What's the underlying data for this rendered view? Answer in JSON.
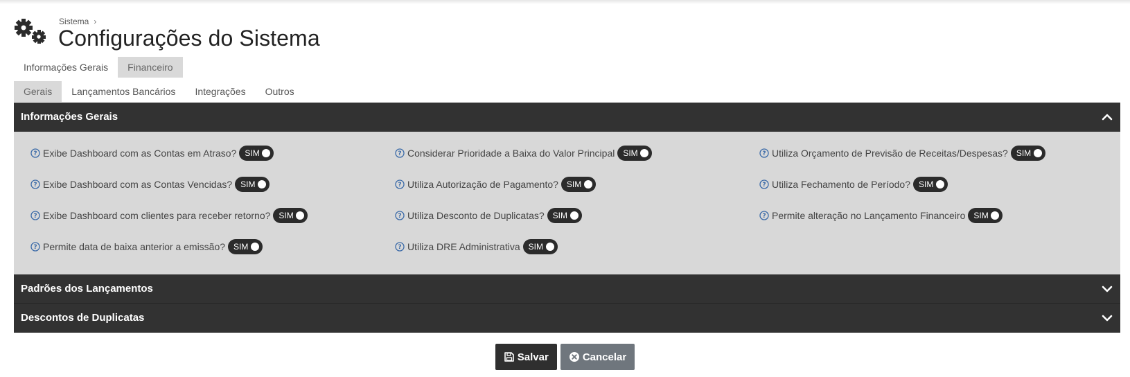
{
  "breadcrumb": {
    "root": "Sistema",
    "separator": "›"
  },
  "page": {
    "title": "Configurações do Sistema"
  },
  "tabs_main": [
    {
      "label": "Informações Gerais",
      "active": false
    },
    {
      "label": "Financeiro",
      "active": true
    }
  ],
  "tabs_sub": [
    {
      "label": "Gerais",
      "active": true
    },
    {
      "label": "Lançamentos Bancários",
      "active": false
    },
    {
      "label": "Integrações",
      "active": false
    },
    {
      "label": "Outros",
      "active": false
    }
  ],
  "sections": {
    "info": {
      "title": "Informações Gerais",
      "expanded": true
    },
    "padroes": {
      "title": "Padrões dos Lançamentos",
      "expanded": false
    },
    "descontos": {
      "title": "Descontos de Duplicatas",
      "expanded": false
    }
  },
  "options": {
    "col1": [
      {
        "label": "Exibe Dashboard com as Contas em Atraso?",
        "value": "SIM"
      },
      {
        "label": "Exibe Dashboard com as Contas Vencidas?",
        "value": "SIM"
      },
      {
        "label": "Exibe Dashboard com clientes para receber retorno?",
        "value": "SIM"
      },
      {
        "label": "Permite data de baixa anterior a emissão?",
        "value": "SIM"
      }
    ],
    "col2": [
      {
        "label": "Considerar Prioridade a Baixa do Valor Principal",
        "value": "SIM"
      },
      {
        "label": "Utiliza Autorização de Pagamento?",
        "value": "SIM"
      },
      {
        "label": "Utiliza Desconto de Duplicatas?",
        "value": "SIM"
      },
      {
        "label": "Utiliza DRE Administrativa",
        "value": "SIM"
      }
    ],
    "col3": [
      {
        "label": "Utiliza Orçamento de Previsão de Receitas/Despesas?",
        "value": "SIM"
      },
      {
        "label": "Utiliza Fechamento de Período?",
        "value": "SIM"
      },
      {
        "label": "Permite alteração no Lançamento Financeiro",
        "value": "SIM"
      }
    ]
  },
  "actions": {
    "save": "Salvar",
    "cancel": "Cancelar"
  },
  "colors": {
    "panel_header": "#323232",
    "panel_body": "#d8d8d8",
    "help_icon": "#3a6aa8",
    "save_button": "#2f2f2f",
    "cancel_button": "#6f767d"
  },
  "icons": {
    "page": "gears-icon",
    "help": "question-circle-icon",
    "collapse": "chevron-up-icon",
    "expand": "chevron-down-icon",
    "save": "floppy-disk-icon",
    "cancel": "x-circle-icon"
  }
}
